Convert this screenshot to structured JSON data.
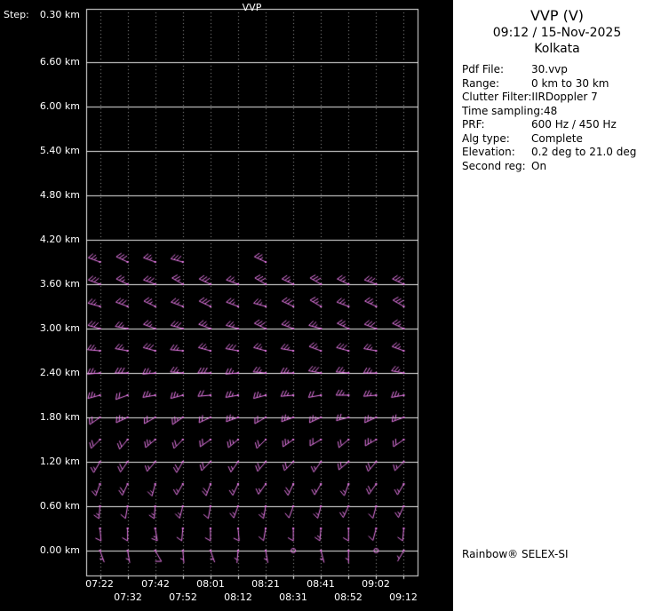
{
  "chart_data": {
    "type": "wind-barb-profile",
    "title": "VVP",
    "barb_color": "#e87ae8",
    "grid_color": "#e8e8e8",
    "dotted_grid_color": "#9a9a9a",
    "background": "#000000",
    "y_axis": {
      "step_prefix": "Step:",
      "step_value": "0.30 km",
      "unit": "km",
      "step_km": 0.3,
      "tick_labels": [
        "6.60 km",
        "6.00 km",
        "5.40 km",
        "4.80 km",
        "4.20 km",
        "3.60 km",
        "3.00 km",
        "2.40 km",
        "1.80 km",
        "1.20 km",
        "0.60 km",
        "0.00 km"
      ]
    },
    "x_axis": {
      "row1": [
        "07:22",
        "07:42",
        "08:01",
        "08:21",
        "08:41",
        "09:02"
      ],
      "row2": [
        "07:32",
        "07:52",
        "08:12",
        "08:31",
        "08:52",
        "09:12"
      ],
      "times": [
        "07:22",
        "07:32",
        "07:42",
        "07:52",
        "08:01",
        "08:12",
        "08:21",
        "08:31",
        "08:52",
        "08:41",
        "09:02",
        "09:12"
      ]
    },
    "levels": [
      {
        "h": 0.0,
        "cells": [
          [
            160,
            5
          ],
          [
            170,
            5
          ],
          [
            150,
            10
          ],
          [
            175,
            5
          ],
          [
            160,
            5
          ],
          [
            185,
            5
          ],
          [
            170,
            5
          ],
          [
            0,
            0
          ],
          [
            165,
            5
          ],
          [
            180,
            5
          ],
          [
            0,
            0
          ],
          [
            210,
            5
          ]
        ]
      },
      {
        "h": 0.3,
        "cells": [
          [
            175,
            10
          ],
          [
            180,
            10
          ],
          [
            170,
            15
          ],
          [
            185,
            10
          ],
          [
            180,
            10
          ],
          [
            175,
            10
          ],
          [
            190,
            10
          ],
          [
            180,
            10
          ],
          [
            185,
            15
          ],
          [
            180,
            10
          ],
          [
            195,
            10
          ],
          [
            185,
            10
          ]
        ]
      },
      {
        "h": 0.6,
        "cells": [
          [
            185,
            15
          ],
          [
            190,
            10
          ],
          [
            185,
            15
          ],
          [
            195,
            15
          ],
          [
            190,
            10
          ],
          [
            200,
            15
          ],
          [
            190,
            15
          ],
          [
            200,
            10
          ],
          [
            195,
            15
          ],
          [
            205,
            15
          ],
          [
            195,
            10
          ],
          [
            205,
            15
          ]
        ]
      },
      {
        "h": 0.9,
        "cells": [
          [
            200,
            15
          ],
          [
            205,
            20
          ],
          [
            195,
            15
          ],
          [
            210,
            15
          ],
          [
            200,
            20
          ],
          [
            205,
            15
          ],
          [
            215,
            15
          ],
          [
            205,
            20
          ],
          [
            210,
            15
          ],
          [
            200,
            15
          ],
          [
            215,
            20
          ],
          [
            210,
            15
          ]
        ]
      },
      {
        "h": 1.2,
        "cells": [
          [
            210,
            15
          ],
          [
            215,
            20
          ],
          [
            220,
            15
          ],
          [
            210,
            20
          ],
          [
            225,
            20
          ],
          [
            215,
            15
          ],
          [
            220,
            20
          ],
          [
            225,
            20
          ],
          [
            215,
            15
          ],
          [
            230,
            20
          ],
          [
            220,
            20
          ],
          [
            225,
            15
          ]
        ]
      },
      {
        "h": 1.5,
        "cells": [
          [
            225,
            20
          ],
          [
            220,
            20
          ],
          [
            230,
            25
          ],
          [
            225,
            20
          ],
          [
            235,
            20
          ],
          [
            230,
            25
          ],
          [
            225,
            20
          ],
          [
            235,
            25
          ],
          [
            240,
            20
          ],
          [
            230,
            20
          ],
          [
            240,
            25
          ],
          [
            235,
            20
          ]
        ]
      },
      {
        "h": 1.8,
        "cells": [
          [
            235,
            20
          ],
          [
            245,
            25
          ],
          [
            240,
            20
          ],
          [
            235,
            25
          ],
          [
            245,
            20
          ],
          [
            250,
            25
          ],
          [
            240,
            20
          ],
          [
            250,
            25
          ],
          [
            245,
            25
          ],
          [
            255,
            20
          ],
          [
            245,
            25
          ],
          [
            250,
            20
          ]
        ]
      },
      {
        "h": 2.1,
        "cells": [
          [
            255,
            25
          ],
          [
            250,
            20
          ],
          [
            260,
            25
          ],
          [
            255,
            25
          ],
          [
            265,
            20
          ],
          [
            260,
            25
          ],
          [
            255,
            25
          ],
          [
            265,
            25
          ],
          [
            260,
            20
          ],
          [
            270,
            25
          ],
          [
            265,
            25
          ],
          [
            260,
            25
          ]
        ]
      },
      {
        "h": 2.4,
        "cells": [
          [
            265,
            25
          ],
          [
            270,
            30
          ],
          [
            265,
            25
          ],
          [
            275,
            25
          ],
          [
            270,
            30
          ],
          [
            265,
            25
          ],
          [
            275,
            25
          ],
          [
            270,
            25
          ],
          [
            280,
            30
          ],
          [
            275,
            25
          ],
          [
            270,
            25
          ],
          [
            280,
            25
          ]
        ]
      },
      {
        "h": 2.7,
        "cells": [
          [
            275,
            25
          ],
          [
            280,
            25
          ],
          [
            285,
            30
          ],
          [
            275,
            25
          ],
          [
            285,
            25
          ],
          [
            280,
            30
          ],
          [
            285,
            25
          ],
          [
            280,
            25
          ],
          [
            290,
            25
          ],
          [
            285,
            30
          ],
          [
            280,
            25
          ],
          [
            290,
            25
          ]
        ]
      },
      {
        "h": 3.0,
        "cells": [
          [
            285,
            30
          ],
          [
            280,
            25
          ],
          [
            290,
            25
          ],
          [
            285,
            30
          ],
          [
            290,
            25
          ],
          [
            285,
            25
          ],
          [
            295,
            30
          ],
          [
            290,
            25
          ],
          [
            285,
            25
          ],
          [
            295,
            25
          ],
          [
            290,
            30
          ],
          [
            295,
            25
          ]
        ]
      },
      {
        "h": 3.3,
        "cells": [
          [
            285,
            25
          ],
          [
            290,
            30
          ],
          [
            295,
            25
          ],
          [
            290,
            25
          ],
          [
            295,
            30
          ],
          [
            290,
            25
          ],
          [
            285,
            25
          ],
          [
            295,
            30
          ],
          [
            300,
            25
          ],
          [
            290,
            25
          ],
          [
            295,
            25
          ],
          [
            300,
            30
          ]
        ]
      },
      {
        "h": 3.6,
        "cells": [
          [
            290,
            30
          ],
          [
            295,
            25
          ],
          [
            290,
            30
          ],
          [
            300,
            25
          ],
          [
            295,
            30
          ],
          [
            290,
            25
          ],
          [
            300,
            30
          ],
          [
            295,
            25
          ],
          [
            300,
            30
          ],
          [
            295,
            25
          ],
          [
            290,
            30
          ],
          [
            295,
            30
          ]
        ]
      },
      {
        "h": 3.9,
        "cells": [
          [
            290,
            25
          ],
          [
            295,
            30
          ],
          [
            290,
            25
          ],
          [
            285,
            30
          ],
          null,
          null,
          [
            295,
            25
          ],
          null,
          null,
          null,
          null,
          null
        ]
      }
    ]
  },
  "info_panel": {
    "title": "VVP (V)",
    "datetime": "09:12 / 15-Nov-2025",
    "site": "Kolkata",
    "fields": [
      {
        "label": "Pdf File:",
        "value": "30.vvp"
      },
      {
        "label": "Range:",
        "value": "0 km to 30 km"
      },
      {
        "label": "Clutter Filter:",
        "value": "IIRDoppler 7"
      },
      {
        "label": "Time sampling:",
        "value": "48"
      },
      {
        "label": "PRF:",
        "value": "600 Hz / 450 Hz"
      },
      {
        "label": "Alg type:",
        "value": "Complete"
      },
      {
        "label": "Elevation:",
        "value": "0.2 deg to 21.0 deg"
      },
      {
        "label": "Second reg:",
        "value": "On"
      }
    ],
    "footer": "Rainbow® SELEX-SI"
  }
}
